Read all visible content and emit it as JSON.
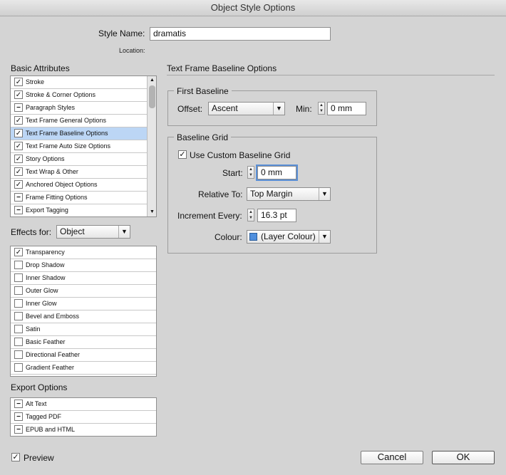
{
  "window": {
    "title": "Object Style Options"
  },
  "header": {
    "style_name_label": "Style Name:",
    "style_name_value": "dramatis",
    "location_label": "Location:"
  },
  "basic_attributes": {
    "title": "Basic Attributes",
    "items": [
      {
        "label": "Stroke",
        "state": "checked"
      },
      {
        "label": "Stroke & Corner Options",
        "state": "checked"
      },
      {
        "label": "Paragraph Styles",
        "state": "mixed"
      },
      {
        "label": "Text Frame General Options",
        "state": "checked"
      },
      {
        "label": "Text Frame Baseline Options",
        "state": "checked",
        "selected": true
      },
      {
        "label": "Text Frame Auto Size Options",
        "state": "checked"
      },
      {
        "label": "Story Options",
        "state": "checked"
      },
      {
        "label": "Text Wrap & Other",
        "state": "checked"
      },
      {
        "label": "Anchored Object Options",
        "state": "checked"
      },
      {
        "label": "Frame Fitting Options",
        "state": "mixed"
      },
      {
        "label": "Export Tagging",
        "state": "mixed"
      }
    ]
  },
  "effects": {
    "label": "Effects for:",
    "target": "Object",
    "items": [
      {
        "label": "Transparency",
        "state": "checked"
      },
      {
        "label": "Drop Shadow",
        "state": "unchecked"
      },
      {
        "label": "Inner Shadow",
        "state": "unchecked"
      },
      {
        "label": "Outer Glow",
        "state": "unchecked"
      },
      {
        "label": "Inner Glow",
        "state": "unchecked"
      },
      {
        "label": "Bevel and Emboss",
        "state": "unchecked"
      },
      {
        "label": "Satin",
        "state": "unchecked"
      },
      {
        "label": "Basic Feather",
        "state": "unchecked"
      },
      {
        "label": "Directional Feather",
        "state": "unchecked"
      },
      {
        "label": "Gradient Feather",
        "state": "unchecked"
      }
    ]
  },
  "export_options": {
    "title": "Export Options",
    "items": [
      {
        "label": "Alt Text",
        "state": "mixed"
      },
      {
        "label": "Tagged PDF",
        "state": "mixed"
      },
      {
        "label": "EPUB and HTML",
        "state": "mixed"
      }
    ]
  },
  "panel": {
    "title": "Text Frame Baseline Options",
    "first_baseline": {
      "title": "First Baseline",
      "offset_label": "Offset:",
      "offset_value": "Ascent",
      "min_label": "Min:",
      "min_value": "0 mm"
    },
    "baseline_grid": {
      "title": "Baseline Grid",
      "use_custom_label": "Use Custom Baseline Grid",
      "use_custom_checked": true,
      "start_label": "Start:",
      "start_value": "0 mm",
      "relative_label": "Relative To:",
      "relative_value": "Top Margin",
      "increment_label": "Increment Every:",
      "increment_value": "16.3 pt",
      "colour_label": "Colour:",
      "colour_value": "(Layer Colour)",
      "colour_swatch": "#4f8fde"
    }
  },
  "footer": {
    "preview_label": "Preview",
    "preview_checked": true,
    "cancel_label": "Cancel",
    "ok_label": "OK"
  },
  "glyphs": {
    "check": "✓",
    "mixed": "−",
    "dropdown_arrow": "▼",
    "up": "▲",
    "down": "▼"
  }
}
